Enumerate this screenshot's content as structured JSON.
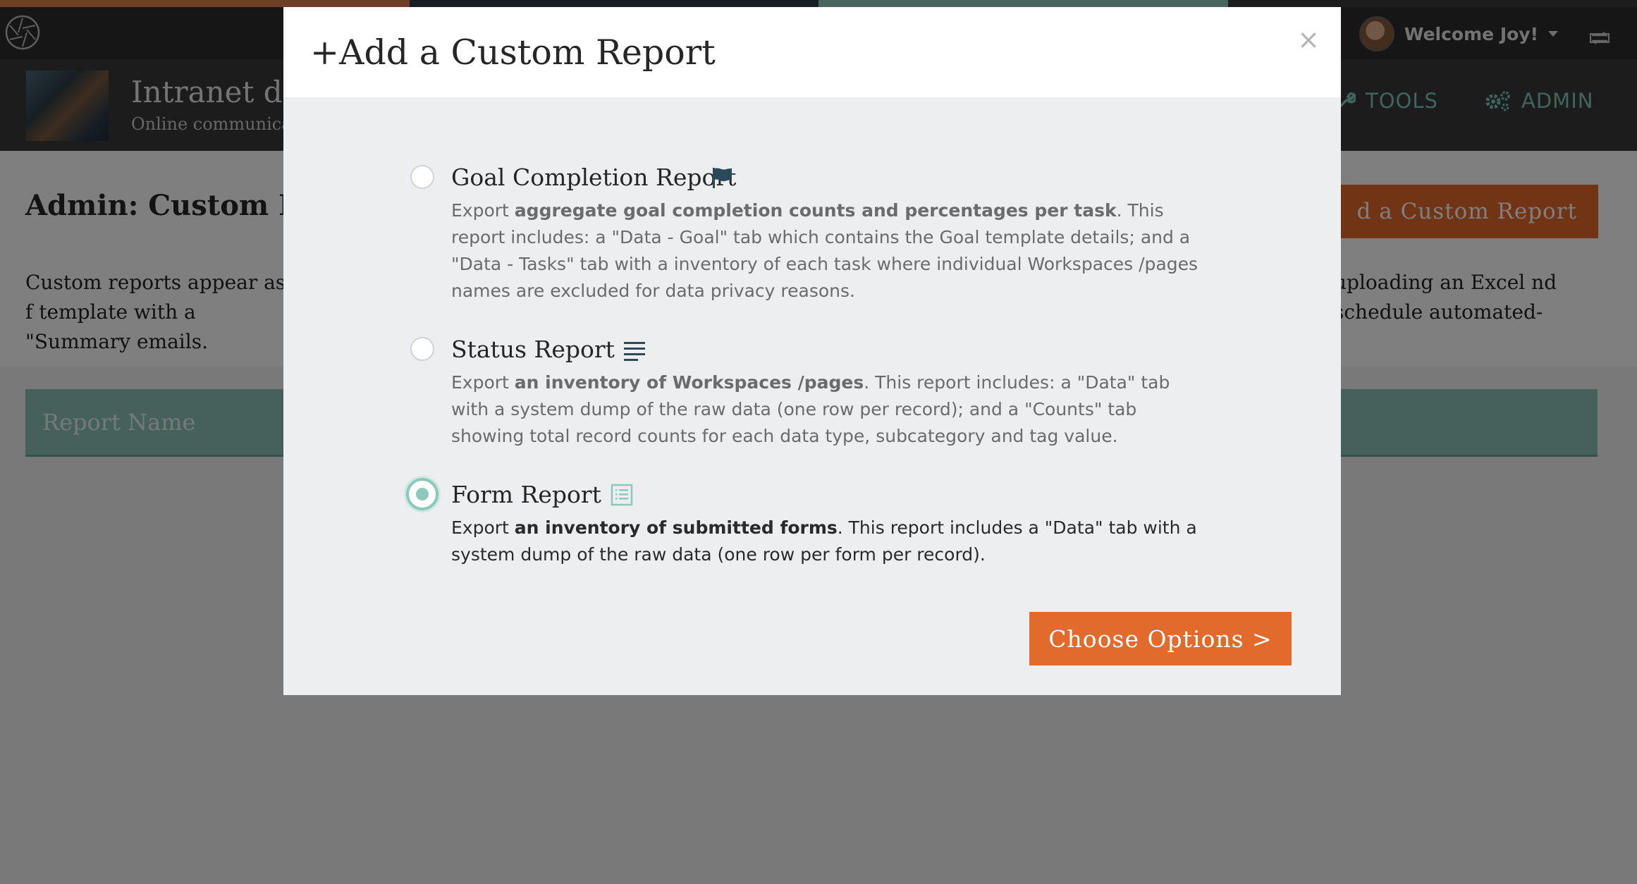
{
  "colors": {
    "accent_orange": "#e26a2c",
    "accent_teal": "#8cc8bb",
    "nav_text": "#7fcbbd",
    "color_bar": [
      "#e07a4a",
      "#2d3e4a",
      "#94c9bd",
      "#3a3a3a"
    ]
  },
  "header": {
    "welcome": "Welcome Joy!",
    "site_title": "Intranet de",
    "site_subtitle": "Online communica",
    "nav_tools": "TOOLS",
    "nav_admin": "ADMIN"
  },
  "page": {
    "title": "Admin: Custom Re",
    "add_button": "d a Custom Report",
    "intro_left": "Custom reports appear as f template with a \"Summary emails.",
    "intro_right": "uploading an Excel nd schedule automated-",
    "table_header": "Report Name"
  },
  "modal": {
    "title": "+Add a Custom Report",
    "close": "×",
    "options": [
      {
        "title": "Goal Completion Report",
        "icon": "flag-icon",
        "checked": false,
        "desc_pre": "Export ",
        "desc_bold": "aggregate goal completion counts and percentages per task",
        "desc_post": ". This report includes: a \"Data - Goal\" tab which contains the Goal template details; and a \"Data - Tasks\" tab with a inventory of each task where individual Workspaces /pages names are excluded for data privacy reasons."
      },
      {
        "title": "Status Report",
        "icon": "list-lines-icon",
        "checked": false,
        "desc_pre": "Export ",
        "desc_bold": "an inventory of Workspaces /pages",
        "desc_post": ". This report includes: a \"Data\" tab with a system dump of the raw data (one row per record); and a \"Counts\" tab showing total record counts for each data type, subcategory and tag value."
      },
      {
        "title": "Form Report",
        "icon": "form-document-icon",
        "checked": true,
        "desc_pre": "Export ",
        "desc_bold": "an inventory of submitted forms",
        "desc_post": ". This report includes a \"Data\" tab with a system dump of the raw data (one row per form per record)."
      }
    ],
    "choose_button": "Choose Options >"
  }
}
